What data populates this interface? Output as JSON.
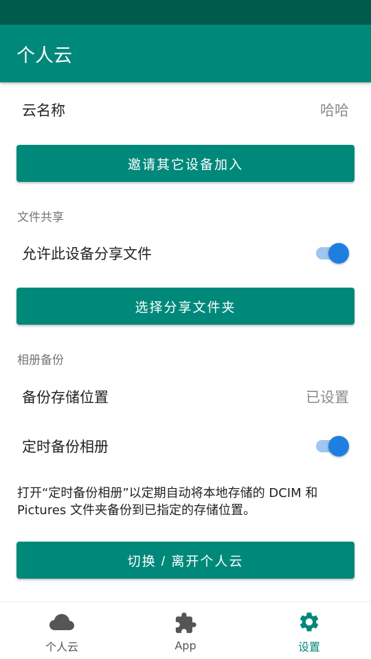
{
  "app_bar": {
    "title": "个人云"
  },
  "cloud_name": {
    "label": "云名称",
    "value": "哈哈"
  },
  "buttons": {
    "invite": "邀请其它设备加入",
    "choose_folder": "选择分享文件夹",
    "switch_leave": "切换 / 离开个人云"
  },
  "file_sharing": {
    "header": "文件共享",
    "allow_share_label": "允许此设备分享文件",
    "allow_share_enabled": true
  },
  "album_backup": {
    "header": "相册备份",
    "storage_location_label": "备份存储位置",
    "storage_location_value": "已设置",
    "scheduled_backup_label": "定时备份相册",
    "scheduled_backup_enabled": true,
    "description": "打开“定时备份相册”以定期自动将本地存储的 DCIM 和 Pictures 文件夹备份到已指定的存储位置。"
  },
  "bottom_nav": {
    "items": [
      {
        "label": "个人云",
        "icon": "cloud-icon",
        "active": false
      },
      {
        "label": "App",
        "icon": "puzzle-icon",
        "active": false
      },
      {
        "label": "设置",
        "icon": "gear-icon",
        "active": true
      }
    ]
  },
  "colors": {
    "primary": "#00897b",
    "status_bar": "#005b4c",
    "toggle_thumb": "#1f7fe0",
    "toggle_track": "#9fc6f0"
  }
}
